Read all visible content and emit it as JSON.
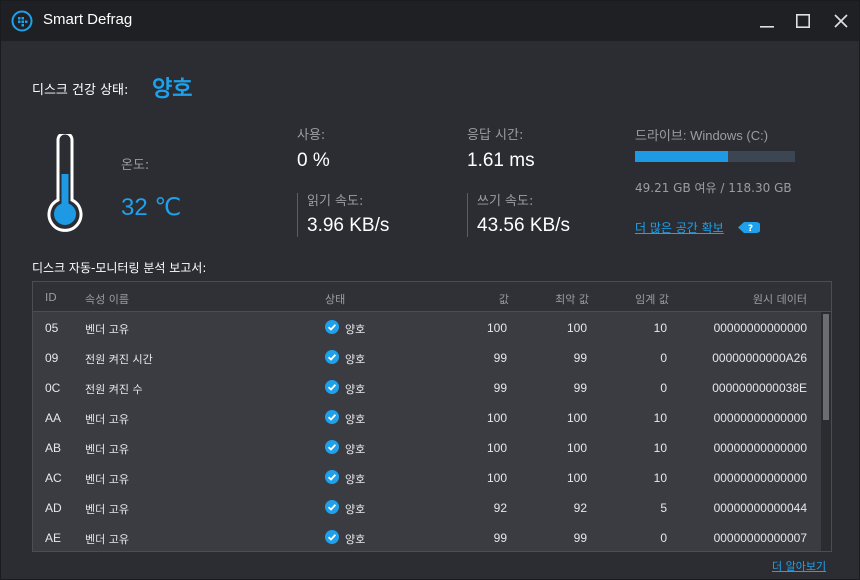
{
  "window": {
    "title": "Smart Defrag"
  },
  "health": {
    "label": "디스크 건강 상태:",
    "value": "양호"
  },
  "temperature": {
    "label": "온도:",
    "value": "32 ℃"
  },
  "stats": {
    "usage": {
      "label": "사용:",
      "value": "0 %"
    },
    "response": {
      "label": "응답 시간:",
      "value": "1.61 ms"
    },
    "read": {
      "label": "읽기 속도:",
      "value": "3.96 KB/s"
    },
    "write": {
      "label": "쓰기 속도:",
      "value": "43.56 KB/s"
    }
  },
  "drive": {
    "label": "드라이브: Windows (C:)",
    "used_fraction": 0.584,
    "space_text": "49.21 GB 여유 / 118.30 GB",
    "more_space_link": "더 많은 공간 확보"
  },
  "colors": {
    "accent": "#1ea1ec",
    "bar_track": "#3c4552"
  },
  "report": {
    "label": "디스크 자동-모니터링 분석 보고서:",
    "columns": [
      "ID",
      "속성 이름",
      "상태",
      "값",
      "최악 값",
      "임계 값",
      "원시 데이터"
    ],
    "rows": [
      {
        "id": "05",
        "name": "벤더 고유",
        "status": "양호",
        "value": "100",
        "worst": "100",
        "threshold": "10",
        "raw": "00000000000000"
      },
      {
        "id": "09",
        "name": "전원 켜진 시간",
        "status": "양호",
        "value": "99",
        "worst": "99",
        "threshold": "0",
        "raw": "00000000000A26"
      },
      {
        "id": "0C",
        "name": "전원 켜진 수",
        "status": "양호",
        "value": "99",
        "worst": "99",
        "threshold": "0",
        "raw": "0000000000038E"
      },
      {
        "id": "AA",
        "name": "벤더 고유",
        "status": "양호",
        "value": "100",
        "worst": "100",
        "threshold": "10",
        "raw": "00000000000000"
      },
      {
        "id": "AB",
        "name": "벤더 고유",
        "status": "양호",
        "value": "100",
        "worst": "100",
        "threshold": "10",
        "raw": "00000000000000"
      },
      {
        "id": "AC",
        "name": "벤더 고유",
        "status": "양호",
        "value": "100",
        "worst": "100",
        "threshold": "10",
        "raw": "00000000000000"
      },
      {
        "id": "AD",
        "name": "벤더 고유",
        "status": "양호",
        "value": "92",
        "worst": "92",
        "threshold": "5",
        "raw": "00000000000044"
      },
      {
        "id": "AE",
        "name": "벤더 고유",
        "status": "양호",
        "value": "99",
        "worst": "99",
        "threshold": "0",
        "raw": "00000000000007"
      }
    ]
  },
  "footer": {
    "learn_more": "더 알아보기"
  }
}
